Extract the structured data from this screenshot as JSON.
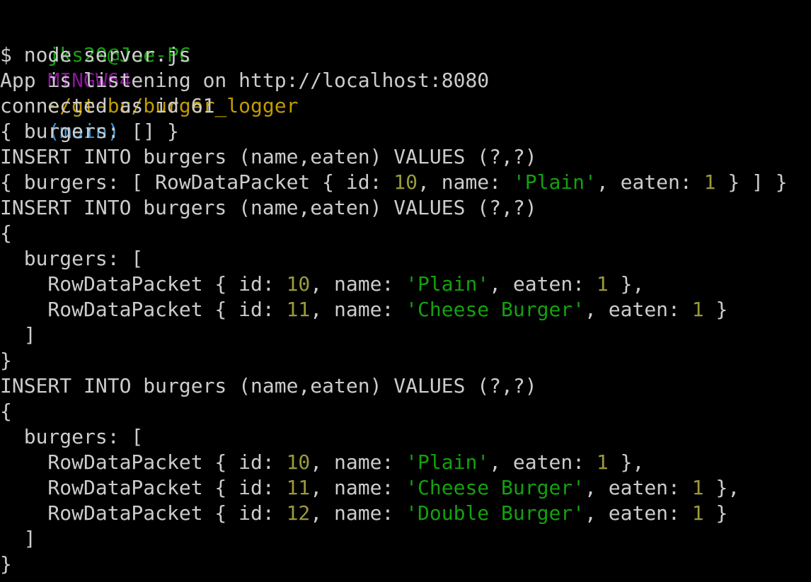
{
  "colors": {
    "background": "#000000",
    "default_text": "#cccccc",
    "prompt_user": "#13a10e",
    "prompt_system": "#881798",
    "prompt_path": "#c19c00",
    "prompt_branch": "#3a96dd",
    "number": "#9b9b3a",
    "string": "#13a10e"
  },
  "prompt": {
    "user_host": "jks20@Joe-PC",
    "system": "MINGW64",
    "path": "~/gt-bc/burger_logger",
    "branch": "(main)"
  },
  "command": "$ node server.js",
  "lines": [
    [
      {
        "t": "App is listening on http://localhost:8080",
        "c": "text"
      }
    ],
    [
      {
        "t": "connected as id 61",
        "c": "text"
      }
    ],
    [
      {
        "t": "{ burgers: [] }",
        "c": "text"
      }
    ],
    [
      {
        "t": "INSERT INTO burgers (name,eaten) VALUES (?,?)",
        "c": "text"
      }
    ],
    [
      {
        "t": "{ burgers: [ RowDataPacket { id: ",
        "c": "text"
      },
      {
        "t": "10",
        "c": "num"
      },
      {
        "t": ", name: ",
        "c": "text"
      },
      {
        "t": "'Plain'",
        "c": "str"
      },
      {
        "t": ", eaten: ",
        "c": "text"
      },
      {
        "t": "1",
        "c": "num"
      },
      {
        "t": " } ] }",
        "c": "text"
      }
    ],
    [
      {
        "t": "INSERT INTO burgers (name,eaten) VALUES (?,?)",
        "c": "text"
      }
    ],
    [
      {
        "t": "{",
        "c": "text"
      }
    ],
    [
      {
        "t": "  burgers: [",
        "c": "text"
      }
    ],
    [
      {
        "t": "    RowDataPacket { id: ",
        "c": "text"
      },
      {
        "t": "10",
        "c": "num"
      },
      {
        "t": ", name: ",
        "c": "text"
      },
      {
        "t": "'Plain'",
        "c": "str"
      },
      {
        "t": ", eaten: ",
        "c": "text"
      },
      {
        "t": "1",
        "c": "num"
      },
      {
        "t": " },",
        "c": "text"
      }
    ],
    [
      {
        "t": "    RowDataPacket { id: ",
        "c": "text"
      },
      {
        "t": "11",
        "c": "num"
      },
      {
        "t": ", name: ",
        "c": "text"
      },
      {
        "t": "'Cheese Burger'",
        "c": "str"
      },
      {
        "t": ", eaten: ",
        "c": "text"
      },
      {
        "t": "1",
        "c": "num"
      },
      {
        "t": " }",
        "c": "text"
      }
    ],
    [
      {
        "t": "  ]",
        "c": "text"
      }
    ],
    [
      {
        "t": "}",
        "c": "text"
      }
    ],
    [
      {
        "t": "INSERT INTO burgers (name,eaten) VALUES (?,?)",
        "c": "text"
      }
    ],
    [
      {
        "t": "{",
        "c": "text"
      }
    ],
    [
      {
        "t": "  burgers: [",
        "c": "text"
      }
    ],
    [
      {
        "t": "    RowDataPacket { id: ",
        "c": "text"
      },
      {
        "t": "10",
        "c": "num"
      },
      {
        "t": ", name: ",
        "c": "text"
      },
      {
        "t": "'Plain'",
        "c": "str"
      },
      {
        "t": ", eaten: ",
        "c": "text"
      },
      {
        "t": "1",
        "c": "num"
      },
      {
        "t": " },",
        "c": "text"
      }
    ],
    [
      {
        "t": "    RowDataPacket { id: ",
        "c": "text"
      },
      {
        "t": "11",
        "c": "num"
      },
      {
        "t": ", name: ",
        "c": "text"
      },
      {
        "t": "'Cheese Burger'",
        "c": "str"
      },
      {
        "t": ", eaten: ",
        "c": "text"
      },
      {
        "t": "1",
        "c": "num"
      },
      {
        "t": " },",
        "c": "text"
      }
    ],
    [
      {
        "t": "    RowDataPacket { id: ",
        "c": "text"
      },
      {
        "t": "12",
        "c": "num"
      },
      {
        "t": ", name: ",
        "c": "text"
      },
      {
        "t": "'Double Burger'",
        "c": "str"
      },
      {
        "t": ", eaten: ",
        "c": "text"
      },
      {
        "t": "1",
        "c": "num"
      },
      {
        "t": " }",
        "c": "text"
      }
    ],
    [
      {
        "t": "  ]",
        "c": "text"
      }
    ],
    [
      {
        "t": "}",
        "c": "text"
      }
    ]
  ]
}
